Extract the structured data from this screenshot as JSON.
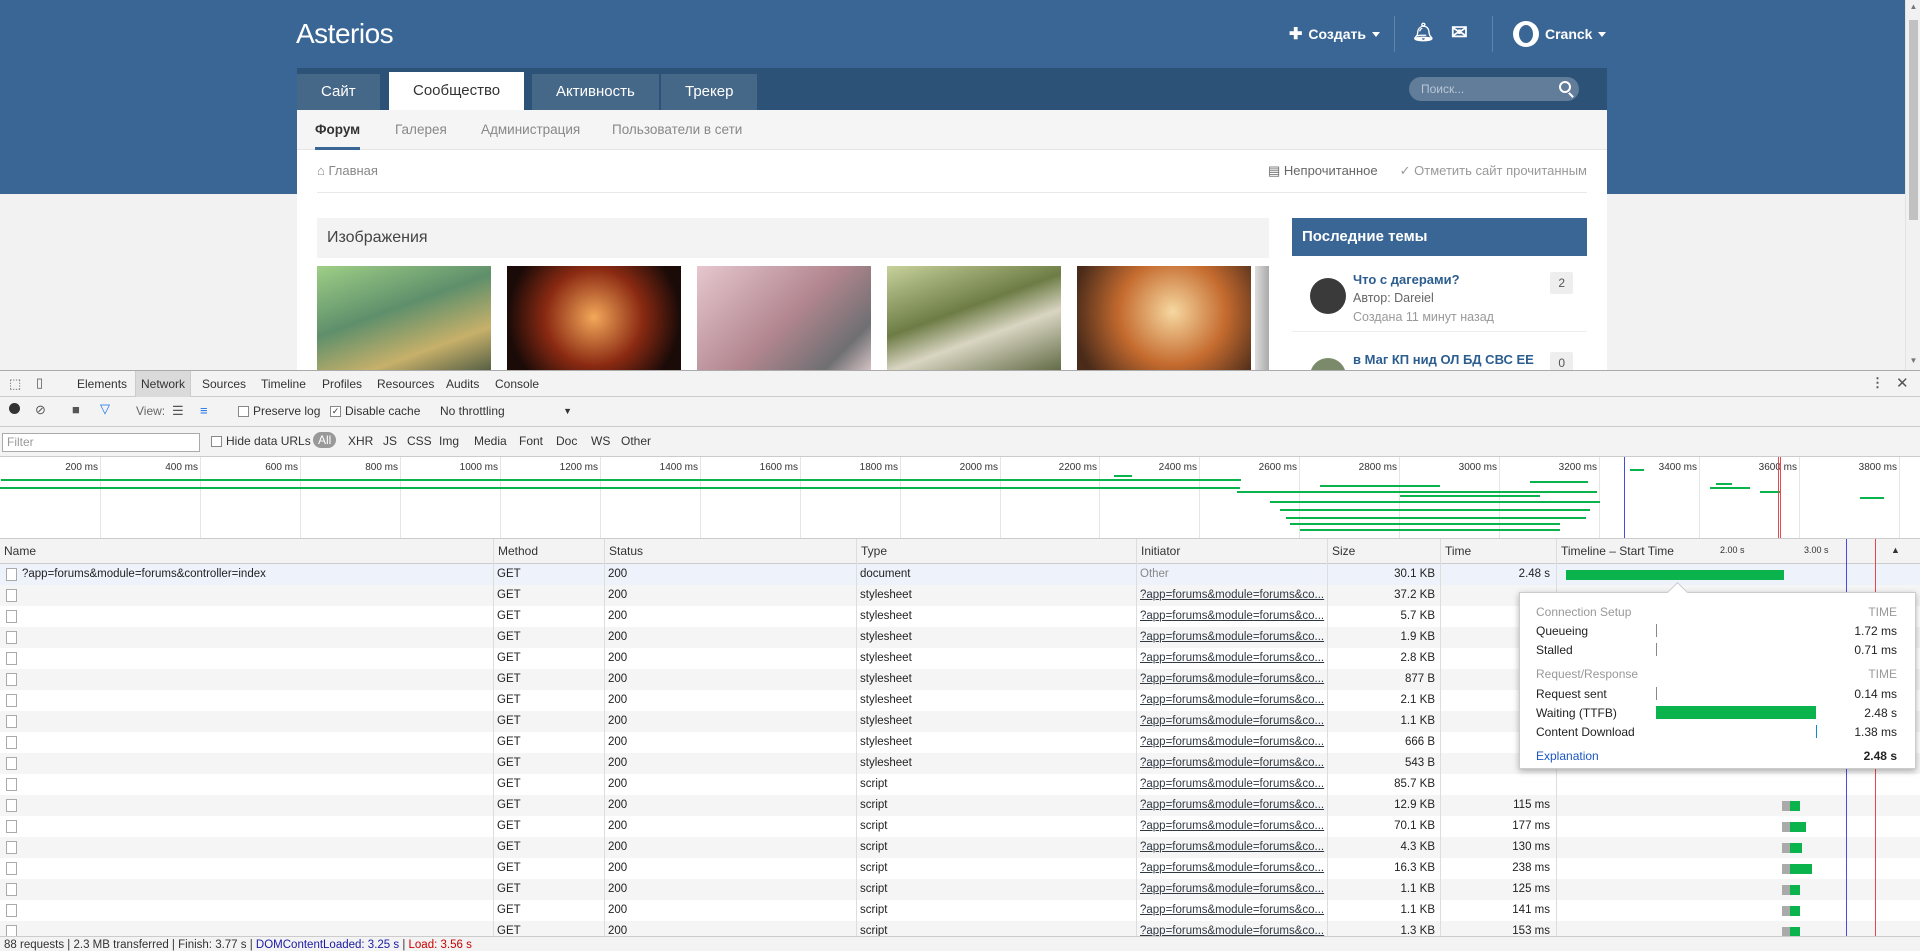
{
  "site": {
    "brand": "Asterios",
    "create_label": "Создать",
    "username": "Cranck",
    "nav_tabs": [
      "Сайт",
      "Сообщество",
      "Активность",
      "Трекер"
    ],
    "search_placeholder": "Поиск...",
    "sub_tabs": [
      "Форум",
      "Галерея",
      "Администрация",
      "Пользователи в сети"
    ],
    "breadcrumb": "Главная",
    "unread_label": "Непрочитанное",
    "mark_read_label": "Отметить сайт прочитанным",
    "images_title": "Изображения",
    "latest_title": "Последние темы",
    "topics": [
      {
        "title": "Что с дагерами?",
        "author": "Автор: Dareiel",
        "created": "Создана 11 минут назад",
        "count": "2"
      },
      {
        "title": "в Маг КП нид ОЛ БД СВС ЕЕ",
        "count": "0"
      }
    ]
  },
  "devtools": {
    "tabs": [
      "Elements",
      "Network",
      "Sources",
      "Timeline",
      "Profiles",
      "Resources",
      "Audits",
      "Console"
    ],
    "toolbar": {
      "view_label": "View:",
      "preserve_log": "Preserve log",
      "disable_cache": "Disable cache",
      "throttling": "No throttling"
    },
    "filter": {
      "placeholder": "Filter",
      "hide_data_urls": "Hide data URLs",
      "types": [
        "All",
        "XHR",
        "JS",
        "CSS",
        "Img",
        "Media",
        "Font",
        "Doc",
        "WS",
        "Other"
      ]
    },
    "overview_ticks": [
      "200 ms",
      "400 ms",
      "600 ms",
      "800 ms",
      "1000 ms",
      "1200 ms",
      "1400 ms",
      "1600 ms",
      "1800 ms",
      "2000 ms",
      "2200 ms",
      "2400 ms",
      "2600 ms",
      "2800 ms",
      "3000 ms",
      "3200 ms",
      "3400 ms",
      "3600 ms",
      "3800 ms"
    ],
    "columns": [
      "Name",
      "Method",
      "Status",
      "Type",
      "Initiator",
      "Size",
      "Time",
      "Timeline – Start Time"
    ],
    "timeline_marks": [
      "2.00 s",
      "3.00 s"
    ],
    "rows": [
      {
        "name": "?app=forums&module=forums&controller=index",
        "method": "GET",
        "status": "200",
        "type": "document",
        "initiator": "Other",
        "size": "30.1 KB",
        "time": "2.48 s"
      },
      {
        "name": "",
        "method": "GET",
        "status": "200",
        "type": "stylesheet",
        "initiator": "?app=forums&module=forums&co...",
        "size": "37.2 KB",
        "time": ""
      },
      {
        "name": "",
        "method": "GET",
        "status": "200",
        "type": "stylesheet",
        "initiator": "?app=forums&module=forums&co...",
        "size": "5.7 KB",
        "time": ""
      },
      {
        "name": "",
        "method": "GET",
        "status": "200",
        "type": "stylesheet",
        "initiator": "?app=forums&module=forums&co...",
        "size": "1.9 KB",
        "time": ""
      },
      {
        "name": "",
        "method": "GET",
        "status": "200",
        "type": "stylesheet",
        "initiator": "?app=forums&module=forums&co...",
        "size": "2.8 KB",
        "time": ""
      },
      {
        "name": "",
        "method": "GET",
        "status": "200",
        "type": "stylesheet",
        "initiator": "?app=forums&module=forums&co...",
        "size": "877 B",
        "time": ""
      },
      {
        "name": "",
        "method": "GET",
        "status": "200",
        "type": "stylesheet",
        "initiator": "?app=forums&module=forums&co...",
        "size": "2.1 KB",
        "time": ""
      },
      {
        "name": "",
        "method": "GET",
        "status": "200",
        "type": "stylesheet",
        "initiator": "?app=forums&module=forums&co...",
        "size": "1.1 KB",
        "time": ""
      },
      {
        "name": "",
        "method": "GET",
        "status": "200",
        "type": "stylesheet",
        "initiator": "?app=forums&module=forums&co...",
        "size": "666 B",
        "time": ""
      },
      {
        "name": "",
        "method": "GET",
        "status": "200",
        "type": "stylesheet",
        "initiator": "?app=forums&module=forums&co...",
        "size": "543 B",
        "time": ""
      },
      {
        "name": "",
        "method": "GET",
        "status": "200",
        "type": "script",
        "initiator": "?app=forums&module=forums&co...",
        "size": "85.7 KB",
        "time": ""
      },
      {
        "name": "",
        "method": "GET",
        "status": "200",
        "type": "script",
        "initiator": "?app=forums&module=forums&co...",
        "size": "12.9 KB",
        "time": "115 ms"
      },
      {
        "name": "",
        "method": "GET",
        "status": "200",
        "type": "script",
        "initiator": "?app=forums&module=forums&co...",
        "size": "70.1 KB",
        "time": "177 ms"
      },
      {
        "name": "",
        "method": "GET",
        "status": "200",
        "type": "script",
        "initiator": "?app=forums&module=forums&co...",
        "size": "4.3 KB",
        "time": "130 ms"
      },
      {
        "name": "",
        "method": "GET",
        "status": "200",
        "type": "script",
        "initiator": "?app=forums&module=forums&co...",
        "size": "16.3 KB",
        "time": "238 ms"
      },
      {
        "name": "",
        "method": "GET",
        "status": "200",
        "type": "script",
        "initiator": "?app=forums&module=forums&co...",
        "size": "1.1 KB",
        "time": "125 ms"
      },
      {
        "name": "",
        "method": "GET",
        "status": "200",
        "type": "script",
        "initiator": "?app=forums&module=forums&co...",
        "size": "1.1 KB",
        "time": "141 ms"
      },
      {
        "name": "",
        "method": "GET",
        "status": "200",
        "type": "script",
        "initiator": "?app=forums&module=forums&co...",
        "size": "1.3 KB",
        "time": "153 ms"
      }
    ],
    "popup": {
      "setup_header": "Connection Setup",
      "time_header": "TIME",
      "queueing": "Queueing",
      "queueing_time": "1.72 ms",
      "stalled": "Stalled",
      "stalled_time": "0.71 ms",
      "response_header": "Request/Response",
      "request_sent": "Request sent",
      "request_sent_time": "0.14 ms",
      "waiting": "Waiting (TTFB)",
      "waiting_time": "2.48 s",
      "download": "Content Download",
      "download_time": "1.38 ms",
      "explanation": "Explanation",
      "total": "2.48 s"
    },
    "status": {
      "requests": "88 requests",
      "transferred": "2.3 MB transferred",
      "finish": "Finish: 3.77 s",
      "dcl": "DOMContentLoaded: 3.25 s",
      "load": "Load: 3.56 s"
    }
  }
}
